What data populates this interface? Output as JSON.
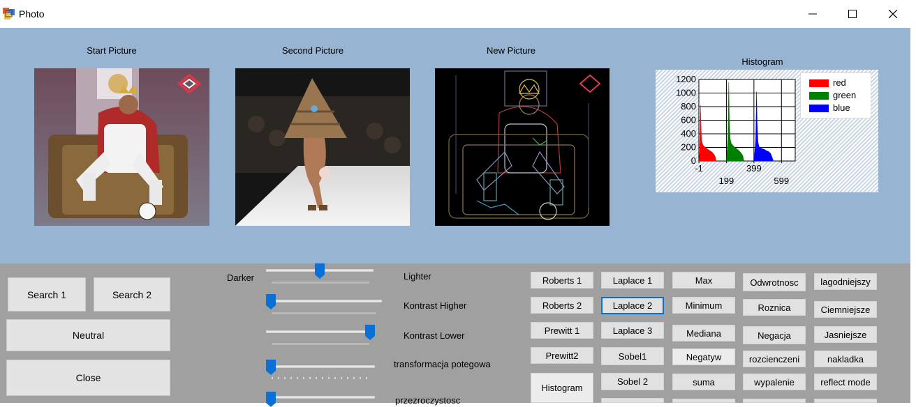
{
  "window": {
    "title": "Photo",
    "icon": "app-icon",
    "minimize": "minimize-icon",
    "maximize": "maximize-icon",
    "close": "close-icon"
  },
  "pictures": {
    "start_caption": "Start Picture",
    "second_caption": "Second Picture",
    "new_caption": "New Picture"
  },
  "histogram": {
    "title": "Histogram",
    "y_ticks": [
      "1200",
      "1000",
      "800",
      "600",
      "400",
      "200",
      "0"
    ],
    "x_ticks_top": [
      "-1",
      "399"
    ],
    "x_ticks_bottom": [
      "199",
      "599"
    ],
    "legend": [
      "red",
      "green",
      "blue"
    ],
    "colors": {
      "red": "#ff0000",
      "green": "#008000",
      "blue": "#0000ff"
    }
  },
  "chart_data": {
    "type": "area",
    "title": "Histogram",
    "xlim": [
      -1,
      699
    ],
    "ylim": [
      0,
      1200
    ],
    "y_ticks": [
      0,
      200,
      400,
      600,
      800,
      1000,
      1200
    ],
    "x_tick_labels": [
      "-1",
      "199",
      "399",
      "599"
    ],
    "legend_position": "top-right",
    "grid": true,
    "series": [
      {
        "name": "red",
        "color": "#ff0000",
        "x": [
          0,
          5,
          8,
          10,
          14,
          18,
          24,
          30,
          40,
          52,
          65,
          80,
          95,
          108,
          118,
          124
        ],
        "y": [
          0,
          120,
          420,
          820,
          560,
          310,
          260,
          230,
          210,
          190,
          170,
          150,
          130,
          100,
          60,
          0
        ]
      },
      {
        "name": "green",
        "color": "#008000",
        "x": [
          200,
          204,
          210,
          216,
          220,
          226,
          234,
          246,
          260,
          275,
          290,
          305,
          318,
          326
        ],
        "y": [
          0,
          140,
          320,
          1160,
          620,
          330,
          260,
          230,
          200,
          180,
          150,
          120,
          80,
          0
        ]
      },
      {
        "name": "blue",
        "color": "#0000ff",
        "x": [
          400,
          405,
          412,
          418,
          422,
          428,
          436,
          448,
          460,
          475,
          490,
          505,
          520,
          530,
          540
        ],
        "y": [
          0,
          130,
          300,
          1020,
          580,
          280,
          210,
          190,
          180,
          170,
          150,
          140,
          110,
          60,
          0
        ]
      }
    ]
  },
  "buttons": {
    "search1": "Search 1",
    "search2": "Search 2",
    "neutral": "Neutral",
    "close": "Close",
    "histogram": "Histogram"
  },
  "sliders": {
    "darker": "Darker",
    "lighter": "Lighter",
    "kontrast_higher": "Kontrast Higher",
    "kontrast_lower": "Kontrast Lower",
    "transformacja": "transformacja potegowa",
    "przezroczystosc": "przezroczystosc",
    "values": {
      "brightness": 0.5,
      "kontrast_higher": 0.0,
      "kontrast_lower": 1.0,
      "transformacja": 0.0,
      "przezroczystosc": 0.0
    }
  },
  "filters": {
    "col1": [
      "Roberts 1",
      "Roberts 2",
      "Prewitt 1",
      "Prewitt2"
    ],
    "col2": [
      "Laplace 1",
      "Laplace 2",
      "Laplace 3",
      "Sobel1",
      "Sobel 2"
    ],
    "col3": [
      "Max",
      "Minimum",
      "Mediana",
      "Negatyw",
      "suma"
    ],
    "col4": [
      "Odwrotnosc",
      "Roznica",
      "Negacja",
      "rozcienczeni",
      "wypalenie"
    ],
    "col5": [
      "lagodniejszy",
      "Ciemniejsze",
      "Jasniejsze",
      "nakladka",
      "reflect mode"
    ]
  }
}
